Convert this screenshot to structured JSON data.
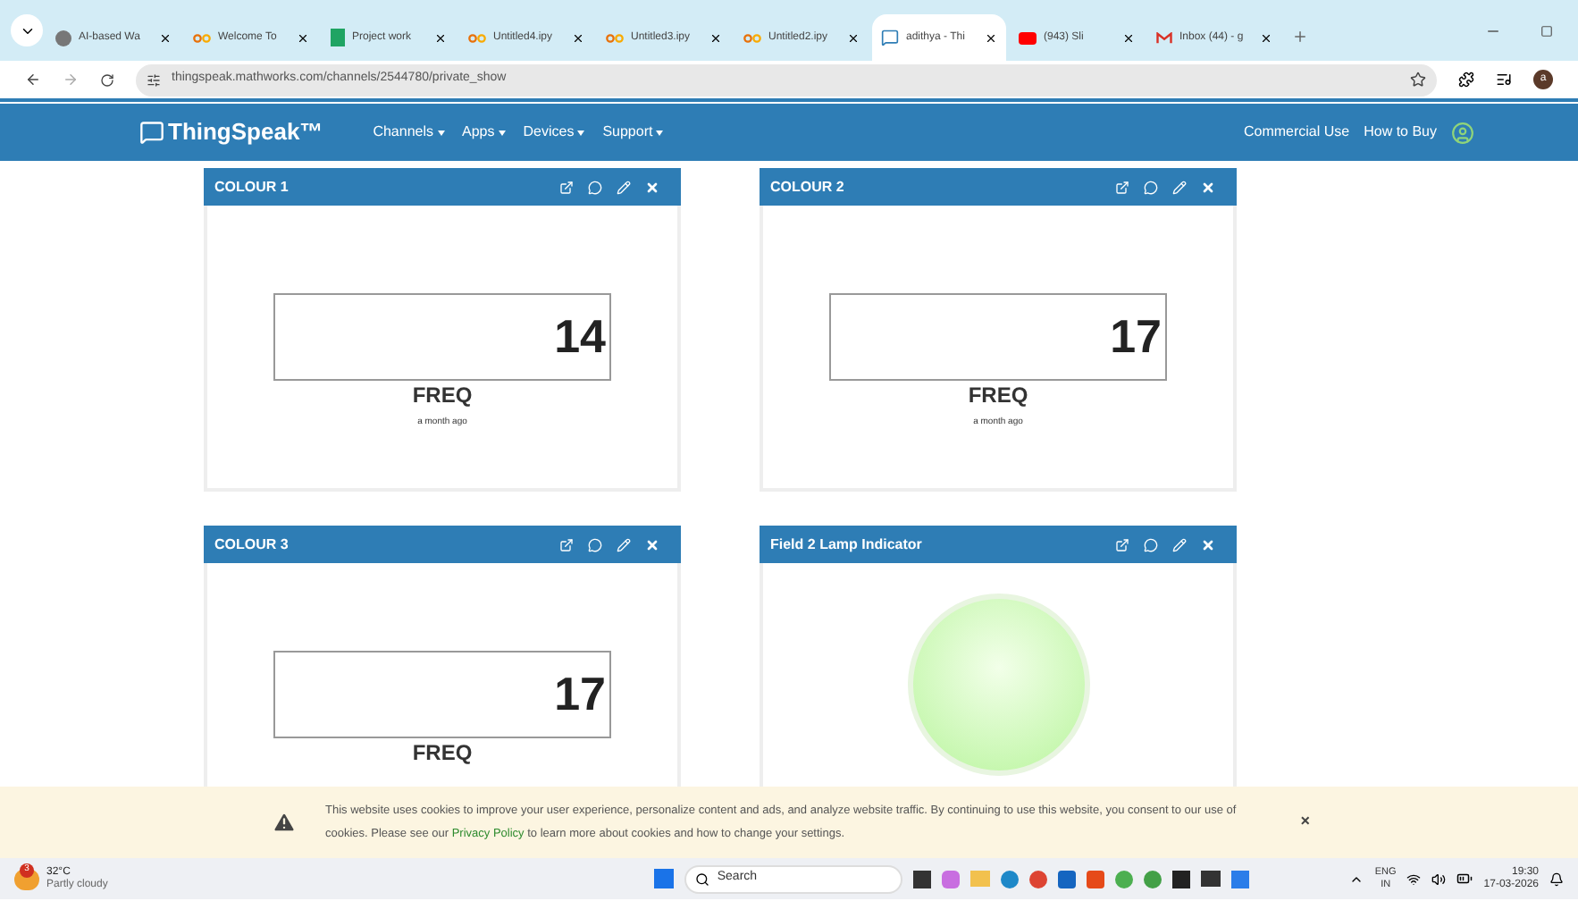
{
  "browser": {
    "tabs": [
      {
        "kind": "globe",
        "label": "AI-based Wa",
        "selected": false
      },
      {
        "kind": "colab",
        "label": "Welcome To",
        "selected": false
      },
      {
        "kind": "sheets",
        "label": "Project work",
        "selected": false
      },
      {
        "kind": "colab",
        "label": "Untitled4.ipy",
        "selected": false
      },
      {
        "kind": "colab",
        "label": "Untitled3.ipy",
        "selected": false
      },
      {
        "kind": "colab",
        "label": "Untitled2.ipy",
        "selected": false
      },
      {
        "kind": "thingspeak",
        "label": "adithya - Thi",
        "selected": true
      },
      {
        "kind": "youtube",
        "label": "(943) Sli",
        "selected": false
      },
      {
        "kind": "gmail",
        "label": "Inbox (44) - g",
        "selected": false
      }
    ],
    "url": "thingspeak.mathworks.com/channels/2544780/private_show",
    "profile": "a"
  },
  "nav": {
    "brand": "ThingSpeak™",
    "menus": [
      "Channels",
      "Apps",
      "Devices",
      "Support"
    ],
    "links": [
      "Commercial Use",
      "How to Buy"
    ]
  },
  "widgets": [
    {
      "kind": "numeric",
      "title": "COLOUR 1",
      "value": "14",
      "label": "FREQ",
      "updated": "a month ago"
    },
    {
      "kind": "numeric",
      "title": "COLOUR 2",
      "value": "17",
      "label": "FREQ",
      "updated": "a month ago"
    },
    {
      "kind": "numeric",
      "title": "COLOUR 3",
      "value": "17",
      "label": "FREQ"
    },
    {
      "kind": "lamp",
      "title": "Field 2 Lamp Indicator",
      "on": true
    }
  ],
  "cookie_banner": {
    "text_before": "This website uses cookies to improve your user experience, personalize content and ads, and analyze website traffic. By continuing to use this website, you consent to our use of cookies. Please see our",
    "link": "Privacy Policy",
    "text_after": "to learn more about cookies and how to change your settings.",
    "close": "×"
  },
  "taskbar": {
    "weather_badge": "3",
    "temperature": "32°C",
    "condition": "Partly cloudy",
    "search_placeholder": "Search",
    "language": "ENG",
    "region": "IN",
    "time": "19:30",
    "date": "17-03-2026"
  }
}
